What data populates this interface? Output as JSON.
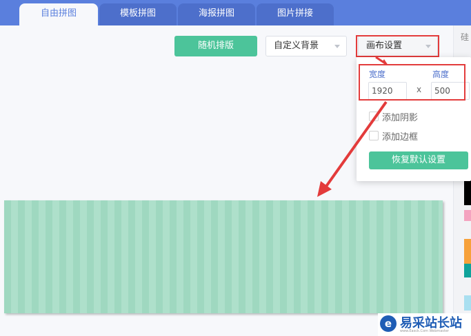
{
  "tabs": [
    {
      "label": "自由拼图",
      "active": true
    },
    {
      "label": "模板拼图",
      "active": false
    },
    {
      "label": "海报拼图",
      "active": false
    },
    {
      "label": "图片拼接",
      "active": false
    }
  ],
  "toolbar": {
    "random_layout_label": "随机排版",
    "custom_bg_label": "自定义背景",
    "canvas_settings_label": "画布设置"
  },
  "canvas_settings": {
    "width_label": "宽度",
    "height_label": "高度",
    "width_value": "1920",
    "height_value": "500",
    "times_sign": "x",
    "add_shadow_label": "添加阴影",
    "add_border_label": "添加边框",
    "add_shadow_checked": false,
    "add_border_checked": false,
    "reset_label": "恢复默认设置"
  },
  "right_panel": {
    "header_char": "硅"
  },
  "watermark": {
    "logo_char": "e",
    "text": "易采站长站",
    "sub": "www.Easck.Com Webmaster"
  },
  "colors": {
    "header_blue": "#5a7fdd",
    "accent_green": "#4cc49a",
    "annotation_red": "#e33b3b",
    "canvas_stripe_a": "#9fd8c0",
    "canvas_stripe_b": "#aee0cb"
  }
}
